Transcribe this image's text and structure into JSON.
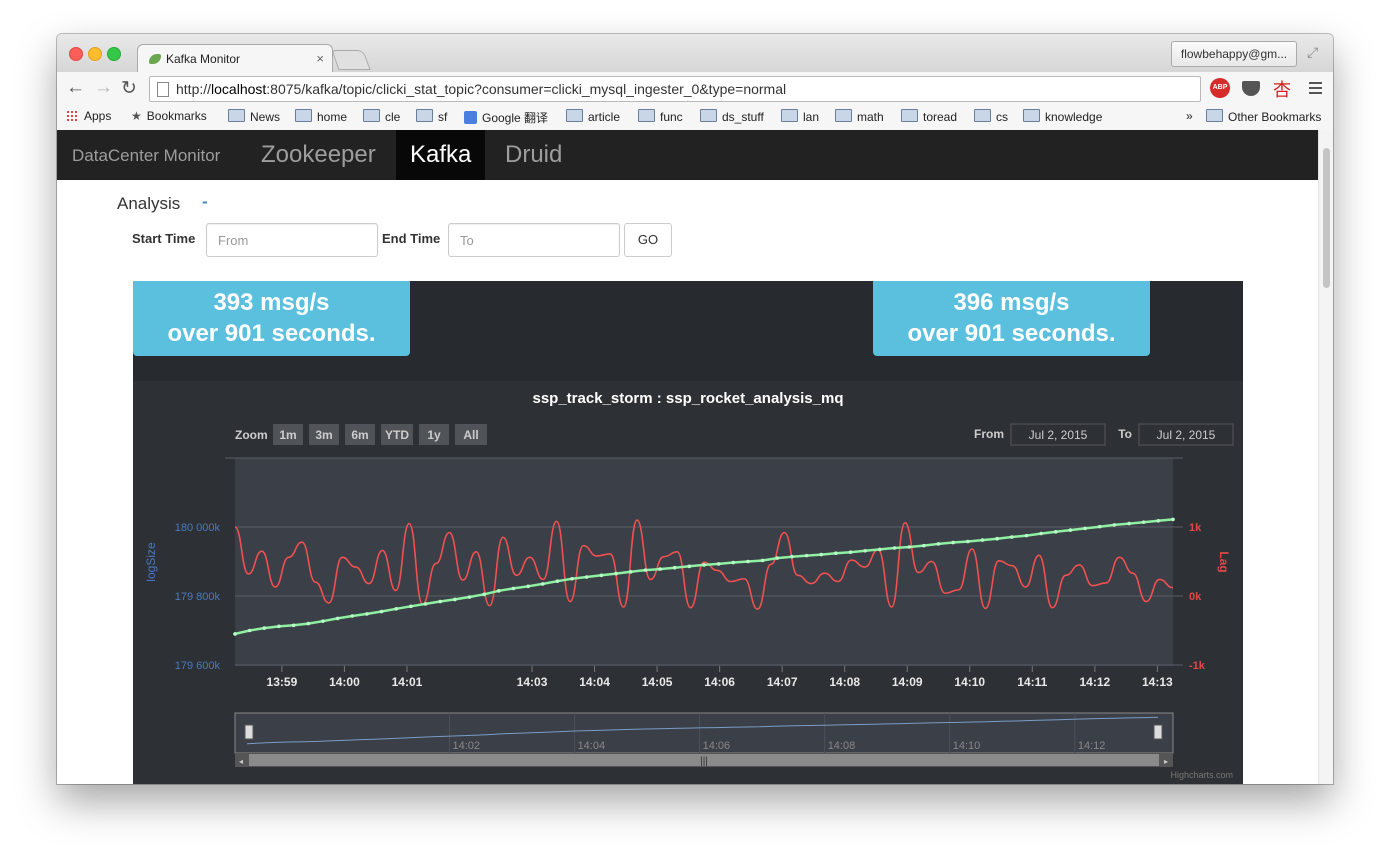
{
  "browser": {
    "tab_title": "Kafka Monitor",
    "tab_close": "×",
    "user": "flowbehappy@gm...",
    "url_prefix": "http://",
    "url_host": "localhost",
    "url_rest": ":8075/kafka/topic/clicki_stat_topic?consumer=clicki_mysql_ingester_0&type=normal",
    "abp": "ABP",
    "han": "杏",
    "bookmarks": [
      "Apps",
      "Bookmarks",
      "News",
      "home",
      "cle",
      "sf",
      "Google 翻译",
      "article",
      "func",
      "ds_stuff",
      "lan",
      "math",
      "toread",
      "cs",
      "knowledge"
    ],
    "more": "»",
    "other_bookmarks": "Other Bookmarks"
  },
  "nav": {
    "brand": "DataCenter Monitor",
    "links": [
      "Zookeeper",
      "Kafka",
      "Druid"
    ],
    "active": "Kafka"
  },
  "analysis": {
    "title": "Analysis",
    "toggle": "-",
    "start_label": "Start Time",
    "start_placeholder": "From",
    "end_label": "End Time",
    "end_placeholder": "To",
    "go": "GO"
  },
  "rates": {
    "left_line1": "393 msg/s",
    "left_line2": "over 901 seconds.",
    "right_line1": "396 msg/s",
    "right_line2": "over 901 seconds."
  },
  "colors": {
    "log_series": "#8ef0a0",
    "lag_series": "#f05050",
    "log_axis": "#4a78c0",
    "lag_axis": "#e04848",
    "rate_box": "#5bc0de"
  },
  "chart_data": {
    "type": "line",
    "title": "ssp_track_storm : ssp_rocket_analysis_mq",
    "zoom_label": "Zoom",
    "zoom_buttons": [
      "1m",
      "3m",
      "6m",
      "YTD",
      "1y",
      "All"
    ],
    "from_label": "From",
    "from_value": "Jul 2, 2015",
    "to_label": "To",
    "to_value": "Jul 2, 2015",
    "credits": "Highcharts.com",
    "y_left": {
      "label": "logSize",
      "ticks": [
        "179 600k",
        "179 800k",
        "180 000k"
      ],
      "range": [
        179600,
        180000
      ]
    },
    "y_right": {
      "label": "Lag",
      "ticks": [
        "-1k",
        "0k",
        "1k"
      ],
      "range": [
        -1000,
        1000
      ]
    },
    "x_ticks": [
      "13:59",
      "14:00",
      "14:01",
      "14:03",
      "14:04",
      "14:05",
      "14:06",
      "14:07",
      "14:08",
      "14:09",
      "14:10",
      "14:11",
      "14:12",
      "14:13"
    ],
    "navigator_ticks": [
      "14:02",
      "14:04",
      "14:06",
      "14:08",
      "14:10",
      "14:12"
    ],
    "series": [
      {
        "name": "logSize",
        "x_range": [
          "13:58:15",
          "14:13:15"
        ],
        "values": [
          179690,
          179700,
          179707,
          179712,
          179715,
          179720,
          179727,
          179735,
          179742,
          179748,
          179755,
          179763,
          179770,
          179777,
          179784,
          179790,
          179797,
          179805,
          179815,
          179822,
          179828,
          179835,
          179843,
          179850,
          179855,
          179860,
          179865,
          179870,
          179875,
          179878,
          179882,
          179886,
          179890,
          179893,
          179897,
          179900,
          179903,
          179910,
          179914,
          179917,
          179920,
          179924,
          179927,
          179931,
          179935,
          179939,
          179942,
          179946,
          179951,
          179955,
          179958,
          179962,
          179966,
          179971,
          179975,
          179981,
          179986,
          179991,
          179996,
          180001,
          180006,
          180010,
          180014,
          180018,
          180022
        ]
      },
      {
        "name": "Lag",
        "x_range": [
          "13:58:15",
          "14:13:15"
        ],
        "values": [
          1000,
          320,
          650,
          130,
          560,
          780,
          200,
          -100,
          560,
          420,
          180,
          660,
          80,
          1050,
          -120,
          470,
          920,
          230,
          640,
          -140,
          850,
          300,
          560,
          240,
          1080,
          -80,
          730,
          580,
          610,
          -160,
          1100,
          240,
          570,
          640,
          -170,
          490,
          370,
          210,
          250,
          -190,
          460,
          920,
          300,
          180,
          330,
          210,
          520,
          420,
          670,
          -160,
          1060,
          340,
          500,
          40,
          90,
          680,
          -180,
          510,
          440,
          130,
          590,
          -170,
          300,
          450,
          150,
          190,
          560,
          330,
          -80,
          240,
          120
        ]
      }
    ],
    "x_tick_times": [
      "13:59",
      "14:00",
      "14:01",
      "14:03",
      "14:04",
      "14:05",
      "14:06",
      "14:07",
      "14:08",
      "14:09",
      "14:10",
      "14:11",
      "14:12",
      "14:13"
    ]
  }
}
